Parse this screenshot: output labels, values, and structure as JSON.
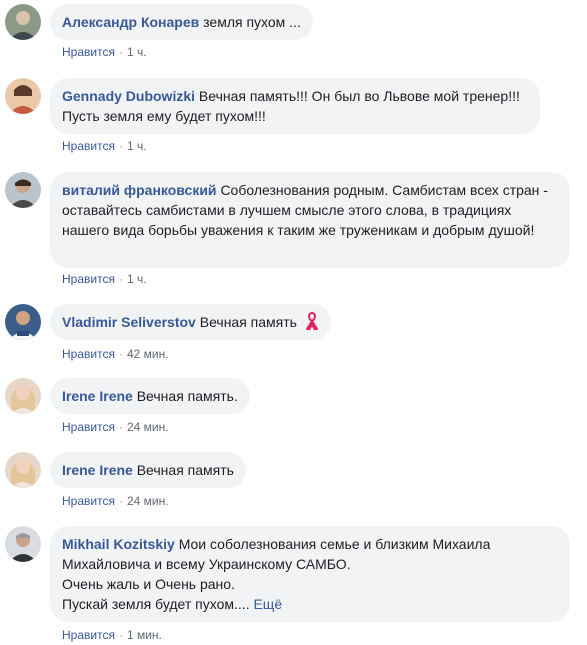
{
  "comments": [
    {
      "author": "Александр Конарев",
      "text": "земля пухом ...",
      "like": "Нравится",
      "sep": "·",
      "time": "1 ч.",
      "avatar": "avatar-photo"
    },
    {
      "author": "Gennady Dubowizki",
      "text": "Вечная память!!! Он был во Львове мой тренер!!! Пусть земля ему будет пухом!!!",
      "like": "Нравится",
      "sep": "·",
      "time": "1 ч.",
      "avatar": "avatar-photo"
    },
    {
      "author": "виталий франковский",
      "text": "Соболезнования родным. Самбистам всех стран - оставайтесь самбистами в лучшем смысле этого слова, в традициях нашего вида борьбы уважения к таким же труженикам и добрым душой!",
      "like": "Нравится",
      "sep": "·",
      "time": "1 ч.",
      "avatar": "avatar-photo"
    },
    {
      "author": "Vladimir Seliverstov",
      "text": "Вечная память",
      "like": "Нравится",
      "sep": "·",
      "time": "42 мин.",
      "avatar": "avatar-photo",
      "emoji": "ribbon-icon"
    },
    {
      "author": "Irene Irene",
      "text": "Вечная память.",
      "like": "Нравится",
      "sep": "·",
      "time": "24 мин.",
      "avatar": "avatar-photo"
    },
    {
      "author": "Irene Irene",
      "text": "Вечная память",
      "like": "Нравится",
      "sep": "·",
      "time": "24 мин.",
      "avatar": "avatar-photo"
    },
    {
      "author": "Mikhail Kozitskiy",
      "text_lines": [
        "Мои соболезнования семье и близким Михаила Михайловича и всему Украинскому САМБО.",
        "Очень жаль и Очень рано.",
        "Пускай земля будет пухом...."
      ],
      "more": "Ещё",
      "like": "Нравится",
      "sep": "·",
      "time": "1 мин.",
      "avatar": "avatar-photo"
    }
  ],
  "colors": {
    "author": "#385898",
    "bubble": "#f2f3f5",
    "meta": "#606770",
    "ribbon": "#e0245e"
  }
}
